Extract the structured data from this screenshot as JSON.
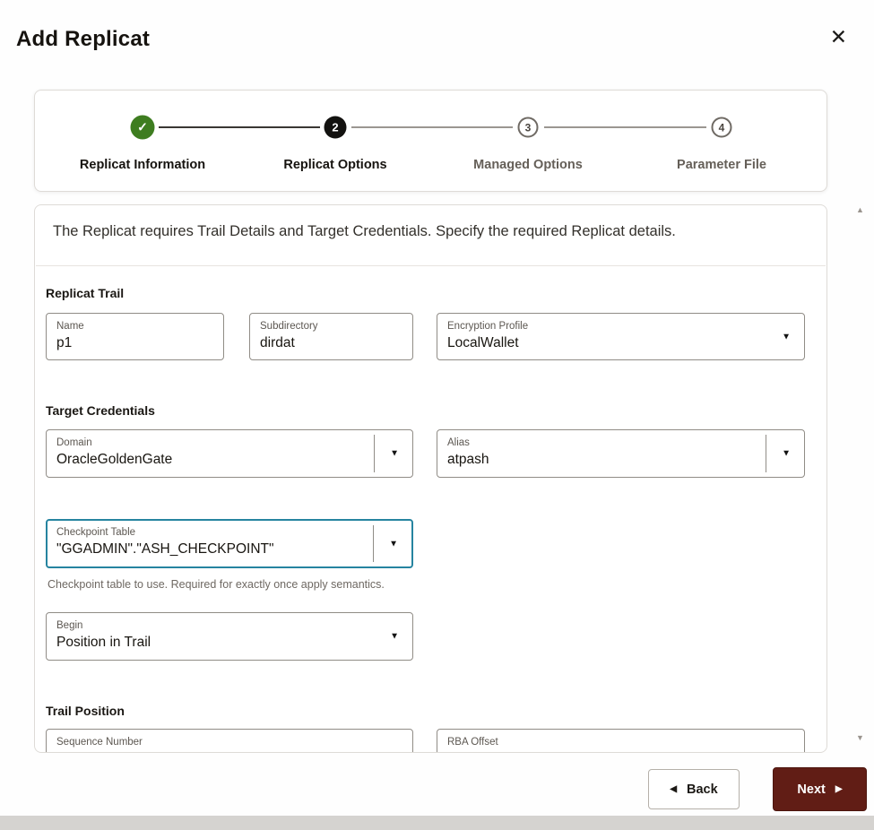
{
  "dialog": {
    "title": "Add Replicat"
  },
  "icons": {
    "close": "✕",
    "dropdown": "▼",
    "back_arrow": "◀",
    "next_arrow": "▶",
    "scroll_up": "▲",
    "scroll_down": "▼"
  },
  "stepper": {
    "steps": [
      {
        "symbol": "✓",
        "label": "Replicat Information",
        "state": "complete"
      },
      {
        "symbol": "2",
        "label": "Replicat Options",
        "state": "active"
      },
      {
        "symbol": "3",
        "label": "Managed Options",
        "state": "upcoming"
      },
      {
        "symbol": "4",
        "label": "Parameter File",
        "state": "upcoming"
      }
    ]
  },
  "form": {
    "description": "The Replicat requires Trail Details and Target Credentials. Specify the required Replicat details.",
    "replicat_trail": {
      "heading": "Replicat Trail",
      "name": {
        "label": "Name",
        "value": "p1"
      },
      "subdirectory": {
        "label": "Subdirectory",
        "value": "dirdat"
      },
      "encryption_profile": {
        "label": "Encryption Profile",
        "value": "LocalWallet"
      }
    },
    "target_credentials": {
      "heading": "Target Credentials",
      "domain": {
        "label": "Domain",
        "value": "OracleGoldenGate"
      },
      "alias": {
        "label": "Alias",
        "value": "atpash"
      },
      "checkpoint_table": {
        "label": "Checkpoint Table",
        "value": "\"GGADMIN\".\"ASH_CHECKPOINT\"",
        "help": "Checkpoint table to use. Required for exactly once apply semantics."
      },
      "begin": {
        "label": "Begin",
        "value": "Position in Trail"
      }
    },
    "trail_position": {
      "heading": "Trail Position",
      "sequence_number": {
        "label": "Sequence Number"
      },
      "rba_offset": {
        "label": "RBA Offset"
      }
    }
  },
  "footer": {
    "back": "Back",
    "next": "Next"
  },
  "colors": {
    "complete_green": "#3E7D20",
    "active_black": "#131210",
    "next_button": "#611D15",
    "focus_teal": "#2684A0"
  }
}
